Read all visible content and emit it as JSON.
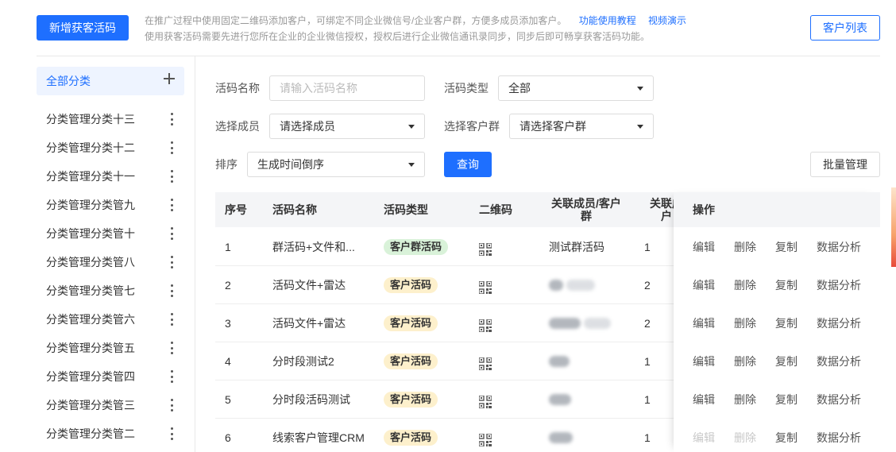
{
  "header": {
    "new_button": "新增获客活码",
    "notice_line1": "在推广过程中使用固定二维码添加客户，可绑定不同企业微信号/企业客户群，方便多成员添加客户。",
    "link_tutorial": "功能使用教程",
    "link_video": "视频演示",
    "notice_line2": "使用获客活码需要先进行您所在企业的企业微信授权，授权后进行企业微信通讯录同步，同步后即可畅享获客活码功能。",
    "customer_list_button": "客户列表"
  },
  "sidebar": {
    "all_label": "全部分类",
    "items": [
      {
        "label": "分类管理分类十三"
      },
      {
        "label": "分类管理分类十二"
      },
      {
        "label": "分类管理分类十一"
      },
      {
        "label": "分类管理分类管九"
      },
      {
        "label": "分类管理分类管十"
      },
      {
        "label": "分类管理分类管八"
      },
      {
        "label": "分类管理分类管七"
      },
      {
        "label": "分类管理分类管六"
      },
      {
        "label": "分类管理分类管五"
      },
      {
        "label": "分类管理分类管四"
      },
      {
        "label": "分类管理分类管三"
      },
      {
        "label": "分类管理分类管二"
      }
    ]
  },
  "filters": {
    "name_label": "活码名称",
    "name_placeholder": "请输入活码名称",
    "type_label": "活码类型",
    "type_value": "全部",
    "member_label": "选择成员",
    "member_value": "请选择成员",
    "group_label": "选择客户群",
    "group_value": "请选择客户群",
    "sort_label": "排序",
    "sort_value": "生成时间倒序",
    "query_button": "查询",
    "batch_button": "批量管理"
  },
  "table": {
    "headers": {
      "index": "序号",
      "name": "活码名称",
      "type": "活码类型",
      "qrcode": "二维码",
      "members_line1": "关联成员/客户",
      "members_line2": "群",
      "count_line1": "关联成",
      "count_line2": "户",
      "actions": "操作"
    },
    "rows": [
      {
        "index": "1",
        "name": "群活码+文件和...",
        "type": "客户群活码",
        "type_color": "#d9f2d9",
        "members": "测试群活码",
        "count": "1",
        "edit_disabled": false
      },
      {
        "index": "2",
        "name": "活码文件+雷达",
        "type": "客户活码",
        "type_color": "#fdf0cc",
        "members": "",
        "count": "2",
        "edit_disabled": false
      },
      {
        "index": "3",
        "name": "活码文件+雷达",
        "type": "客户活码",
        "type_color": "#fdf0cc",
        "members": "",
        "count": "2",
        "edit_disabled": false
      },
      {
        "index": "4",
        "name": "分时段测试2",
        "type": "客户活码",
        "type_color": "#fdf0cc",
        "members": "",
        "count": "1",
        "edit_disabled": false
      },
      {
        "index": "5",
        "name": "分时段活码测试",
        "type": "客户活码",
        "type_color": "#fdf0cc",
        "members": "",
        "count": "1",
        "edit_disabled": false
      },
      {
        "index": "6",
        "name": "线索客户管理CRM",
        "type": "客户活码",
        "type_color": "#fdf0cc",
        "members": "",
        "count": "1",
        "edit_disabled": true
      }
    ],
    "actions": {
      "edit": "编辑",
      "delete": "删除",
      "copy": "复制",
      "analytics": "数据分析"
    }
  }
}
